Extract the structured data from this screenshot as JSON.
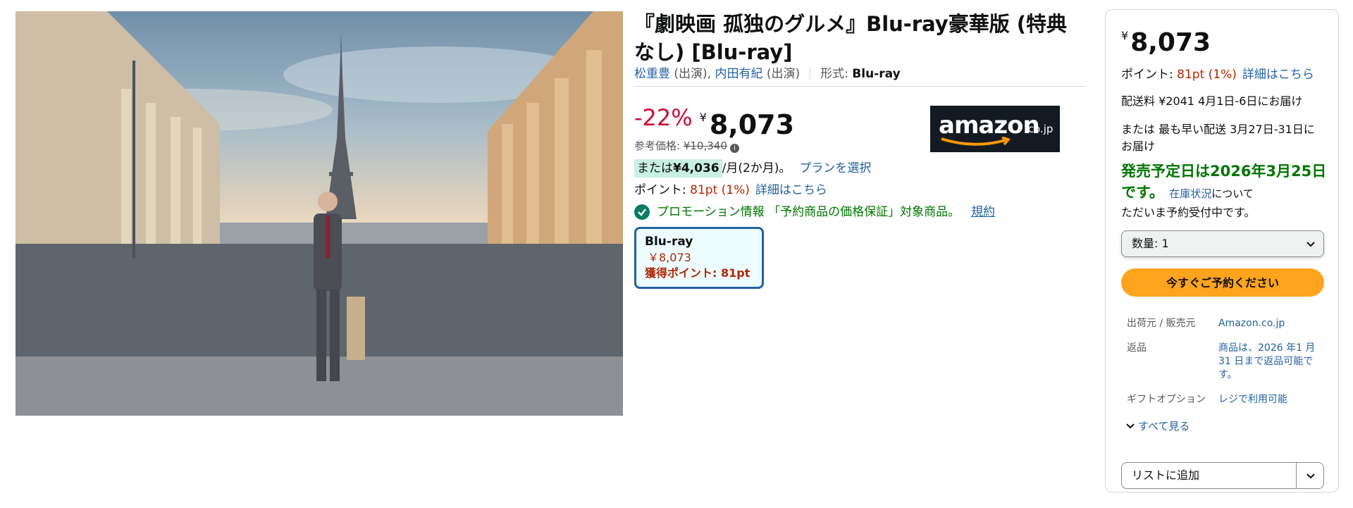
{
  "product": {
    "title": "『劇映画 孤独のグルメ』Blu-ray豪華版 (特典なし) [Blu-ray]",
    "actor1": "松重豊",
    "actor1_role": " (出演), ",
    "actor2": "内田有紀",
    "actor2_role": " (出演)",
    "format_label": "形式: ",
    "format_value": "Blu-ray"
  },
  "pricing": {
    "discount": "-22%",
    "currency": "¥",
    "price": "8,073",
    "list_price_label": "参考価格: ",
    "list_price": "¥10,340",
    "installment_prefix": "または",
    "installment_amount": "¥4,036",
    "installment_suffix": "/月(2か月)。",
    "installment_link": "プランを選択",
    "points_label": "ポイント: ",
    "points_value": "81pt (1%)",
    "points_link": "詳細はこちら"
  },
  "promo": {
    "text": "プロモーション情報 「予約商品の価格保証」対象商品。",
    "link": "規約"
  },
  "format_option": {
    "name": "Blu-ray",
    "price": "￥8,073",
    "points": "獲得ポイント: 81pt"
  },
  "logo": {
    "word": "amazon",
    "tld": ".co.jp"
  },
  "buybox": {
    "currency": "¥",
    "price": "8,073",
    "points_label": "ポイント: ",
    "points_value": "81pt (1%)",
    "points_link": "詳細はこちら",
    "delivery": "配送料 ¥2041 4月1日-6日にお届け",
    "fastest": "または 最も早い配送 3月27日-31日にお届け",
    "release": "発売予定日は2026年3月25日です。",
    "stock_link": "在庫状況",
    "stock_tail": "について",
    "reserve_note": "ただいま予約受付中です。",
    "quantity": "数量: 1",
    "preorder_button": "今すぐご予約ください",
    "details": [
      {
        "key": "出荷元 / 販売元",
        "value": "Amazon.co.jp"
      },
      {
        "key": "返品",
        "value": "商品は、2026 年1 月 31 日まで返品可能です。"
      },
      {
        "key": "ギフトオプション",
        "value": "レジで利用可能"
      }
    ],
    "see_all": "すべて見る",
    "add_to_list": "リストに追加"
  },
  "colors": {
    "discount": "#cc0c39",
    "link": "#2162a1",
    "points": "#b12704",
    "release_green": "#007600",
    "preorder_button": "#ffa41c"
  }
}
